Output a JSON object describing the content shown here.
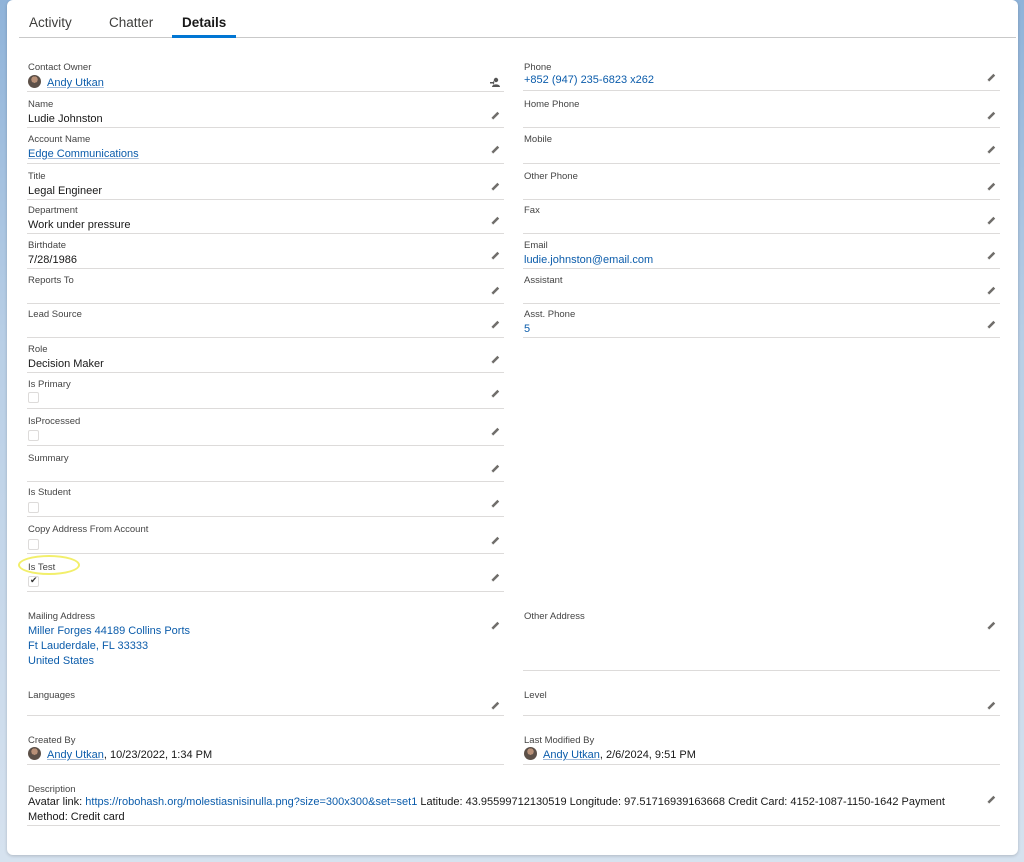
{
  "tabs": [
    {
      "label": "Activity"
    },
    {
      "label": "Chatter"
    },
    {
      "label": "Details"
    }
  ],
  "left": {
    "contact_owner": {
      "label": "Contact Owner",
      "value": "Andy Utkan"
    },
    "name": {
      "label": "Name",
      "value": "Ludie Johnston"
    },
    "account_name": {
      "label": "Account Name",
      "value": "Edge Communications"
    },
    "title": {
      "label": "Title",
      "value": "Legal Engineer"
    },
    "department": {
      "label": "Department",
      "value": "Work under pressure"
    },
    "birthdate": {
      "label": "Birthdate",
      "value": "7/28/1986"
    },
    "reports_to": {
      "label": "Reports To",
      "value": ""
    },
    "lead_source": {
      "label": "Lead Source",
      "value": ""
    },
    "role": {
      "label": "Role",
      "value": "Decision Maker"
    },
    "is_primary": {
      "label": "Is Primary",
      "checked": false
    },
    "is_processed": {
      "label": "IsProcessed",
      "checked": false
    },
    "summary": {
      "label": "Summary",
      "value": ""
    },
    "is_student": {
      "label": "Is Student",
      "checked": false
    },
    "copy_address": {
      "label": "Copy Address From Account",
      "checked": false
    },
    "is_test": {
      "label": "Is Test",
      "checked": true
    }
  },
  "right": {
    "phone": {
      "label": "Phone",
      "value": "+852 (947) 235-6823 x262"
    },
    "home_phone": {
      "label": "Home Phone",
      "value": ""
    },
    "mobile": {
      "label": "Mobile",
      "value": ""
    },
    "other_phone": {
      "label": "Other Phone",
      "value": ""
    },
    "fax": {
      "label": "Fax",
      "value": ""
    },
    "email": {
      "label": "Email",
      "value": "ludie.johnston@email.com"
    },
    "assistant": {
      "label": "Assistant",
      "value": ""
    },
    "asst_phone": {
      "label": "Asst. Phone",
      "value": "5"
    }
  },
  "address": {
    "mailing_label": "Mailing Address",
    "mailing_line1": "Miller Forges 44189 Collins Ports",
    "mailing_line2": "Ft Lauderdale, FL 33333",
    "mailing_line3": "United States",
    "other_label": "Other Address"
  },
  "misc": {
    "languages_label": "Languages",
    "level_label": "Level",
    "created_label": "Created By",
    "created_user": "Andy Utkan",
    "created_date": ", 10/23/2022, 1:34 PM",
    "modified_label": "Last Modified By",
    "modified_user": "Andy Utkan",
    "modified_date": ", 2/6/2024, 9:51 PM",
    "description_label": "Description",
    "desc_prefix": "Avatar link: ",
    "desc_link": "https://robohash.org/molestiasnisinulla.png?size=300x300&set=set1",
    "desc_rest": " Latitude: 43.95599712130519 Longitude: 97.51716939163668 Credit Card: 4152-1087-1150-1642 Payment Method: Credit card"
  },
  "icons": {
    "edit": "pencil-icon",
    "change_owner": "change-owner-icon",
    "avatar": "user-avatar"
  },
  "colors": {
    "link": "#0b5cab",
    "active_tab": "#0176d3",
    "highlight": "#f2ef6b"
  }
}
